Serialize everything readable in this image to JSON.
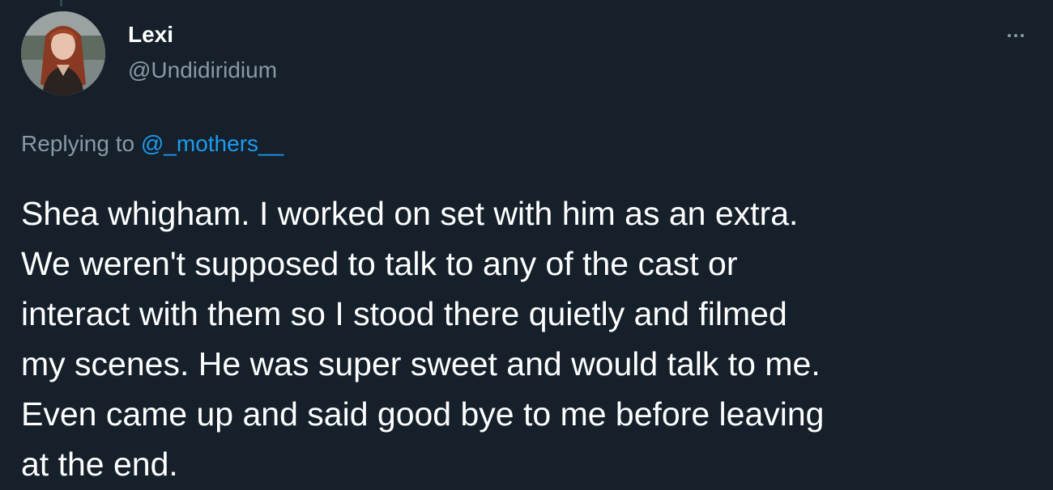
{
  "tweet": {
    "author": {
      "display_name": "Lexi",
      "handle": "@Undidiridium",
      "avatar_icon": "profile-photo"
    },
    "more_icon": "ellipsis-icon",
    "reply": {
      "prefix": "Replying to ",
      "mention": "@_mothers__"
    },
    "text_lines": [
      "Shea whigham. I worked on set with him as an extra.",
      "We weren't supposed to talk to any of the cast or",
      "interact with them so I stood there quietly and filmed",
      "my scenes. He was super sweet and would talk to me.",
      "Even came up and said good bye to me before leaving",
      "at the end."
    ]
  },
  "colors": {
    "background": "#15202b",
    "primary_text": "#ffffff",
    "secondary_text": "#8b98a5",
    "link": "#1d9bf0"
  }
}
